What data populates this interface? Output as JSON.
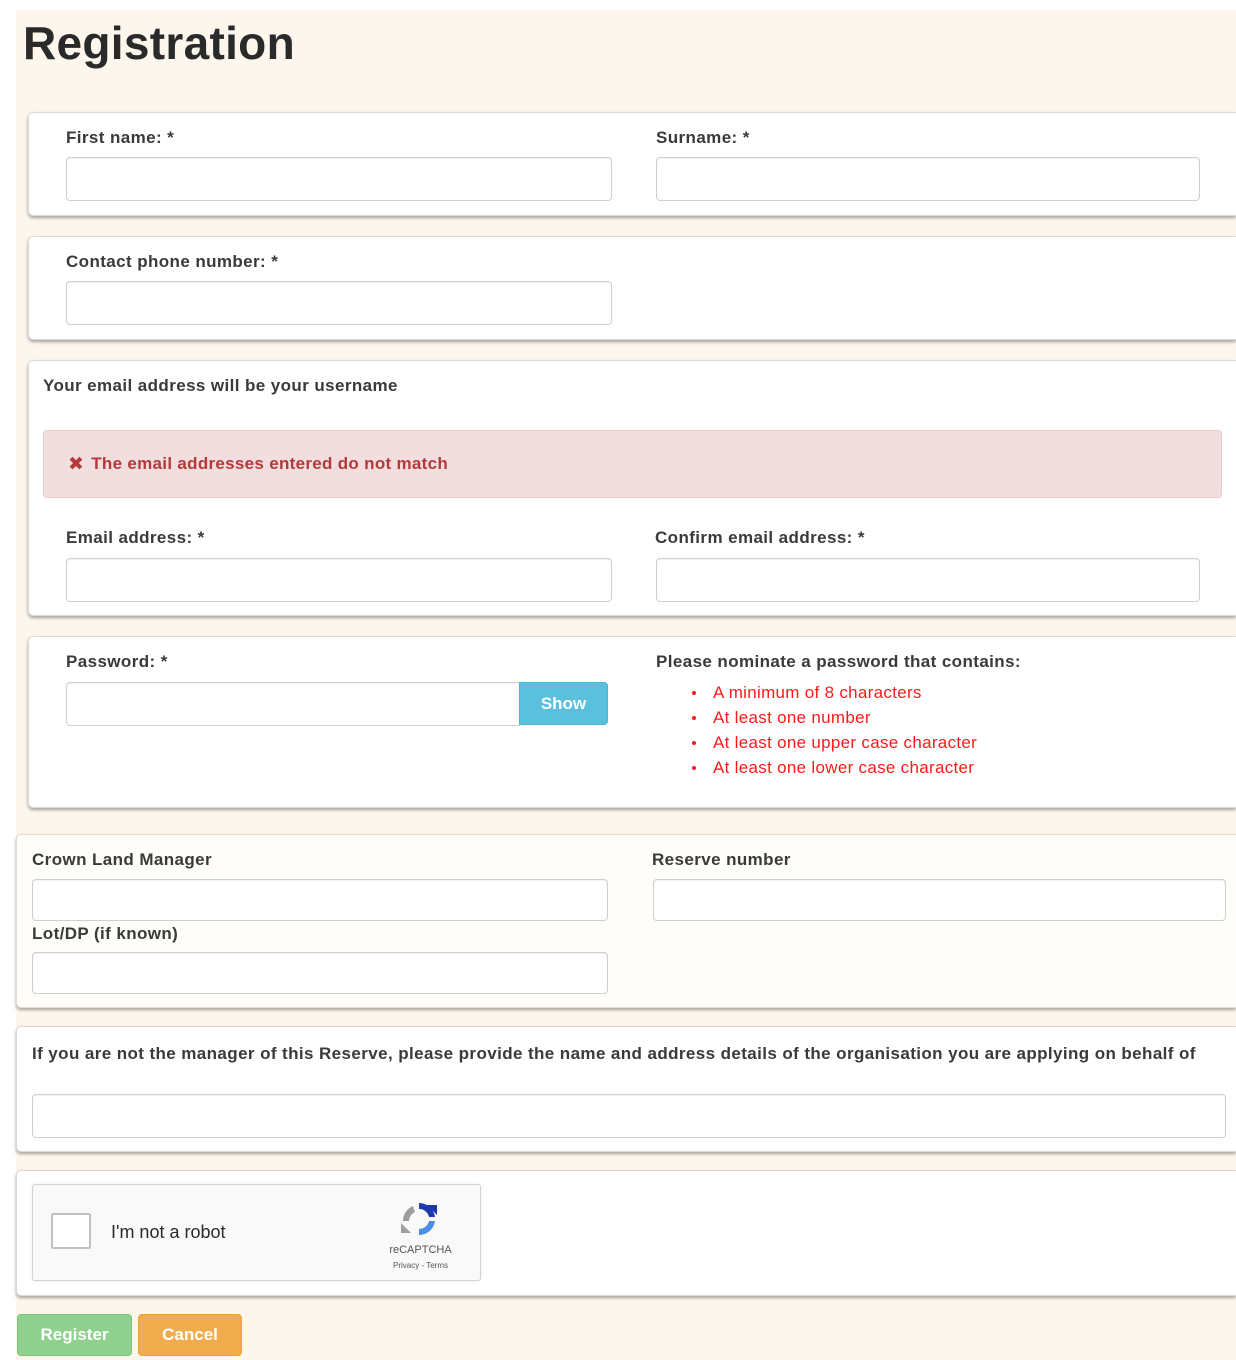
{
  "page": {
    "title": "Registration"
  },
  "name_section": {
    "first_name_label": "First name: *",
    "first_name_value": "",
    "surname_label": "Surname: *",
    "surname_value": ""
  },
  "phone_section": {
    "phone_label": "Contact phone number: *",
    "phone_value": ""
  },
  "email_section": {
    "note": "Your email address will be your username",
    "error_icon": "✖",
    "error_message": "The email addresses entered do not match",
    "email_label": "Email address: *",
    "email_value": "",
    "confirm_label": "Confirm email address: *",
    "confirm_value": ""
  },
  "password_section": {
    "password_label": "Password: *",
    "password_value": "",
    "show_label": "Show",
    "rules_title": "Please nominate a password that contains:",
    "rules": [
      "A minimum of 8 characters",
      "At least one number",
      "At least one upper case character",
      "At least one lower case character"
    ]
  },
  "land_section": {
    "crown_land_label": "Crown Land Manager",
    "crown_land_value": "",
    "reserve_label": "Reserve number",
    "reserve_value": "",
    "lot_label": "Lot/DP (if known)",
    "lot_value": ""
  },
  "org_section": {
    "label": "If you are not the manager of this Reserve, please provide the name and address details of the organisation you are applying on behalf of",
    "value": ""
  },
  "captcha": {
    "text": "I'm not a robot",
    "brand": "reCAPTCHA",
    "links": "Privacy - Terms"
  },
  "actions": {
    "register_label": "Register",
    "cancel_label": "Cancel"
  },
  "colors": {
    "page_background": "#fdf6ec",
    "error_text": "#b23a3a",
    "error_background": "#f2dede",
    "rule_text": "#ff1a1a",
    "show_button": "#5bc0de",
    "register_button": "#8fd08f",
    "cancel_button": "#f0ad4e"
  }
}
